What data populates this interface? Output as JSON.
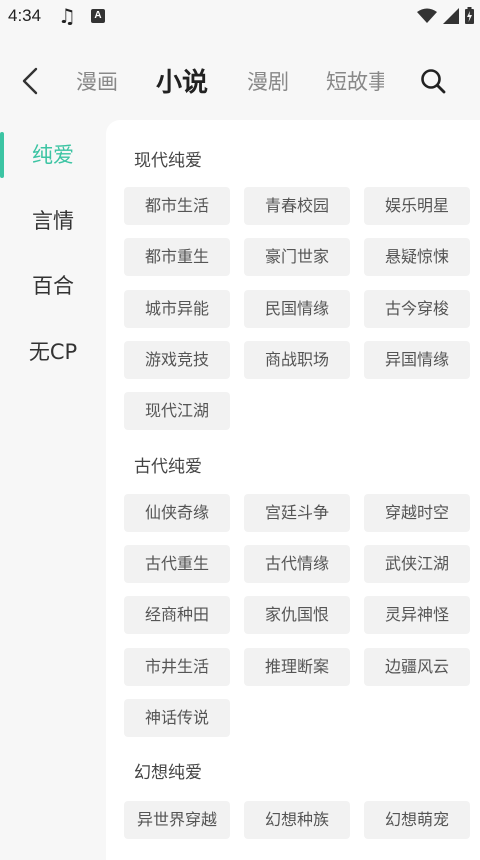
{
  "status": {
    "time": "4:34",
    "app_badge": "A"
  },
  "nav": {
    "tabs": [
      {
        "label": "漫画"
      },
      {
        "label": "小说"
      },
      {
        "label": "漫剧"
      },
      {
        "label": "短故事"
      }
    ],
    "active_tab": "小说"
  },
  "sidebar": {
    "items": [
      {
        "label": "纯爱"
      },
      {
        "label": "言情"
      },
      {
        "label": "百合"
      },
      {
        "label": "无CP"
      }
    ],
    "active": "纯爱",
    "accent_color": "#3cc4a3"
  },
  "sections": [
    {
      "title": "现代纯爱",
      "tags": [
        "都市生活",
        "青春校园",
        "娱乐明星",
        "都市重生",
        "豪门世家",
        "悬疑惊悚",
        "城市异能",
        "民国情缘",
        "古今穿梭",
        "游戏竞技",
        "商战职场",
        "异国情缘",
        "现代江湖"
      ]
    },
    {
      "title": "古代纯爱",
      "tags": [
        "仙侠奇缘",
        "宫廷斗争",
        "穿越时空",
        "古代重生",
        "古代情缘",
        "武侠江湖",
        "经商种田",
        "家仇国恨",
        "灵异神怪",
        "市井生活",
        "推理断案",
        "边疆风云",
        "神话传说"
      ]
    },
    {
      "title": "幻想纯爱",
      "tags": [
        "异世界穿越",
        "幻想种族",
        "幻想萌宠"
      ]
    }
  ]
}
